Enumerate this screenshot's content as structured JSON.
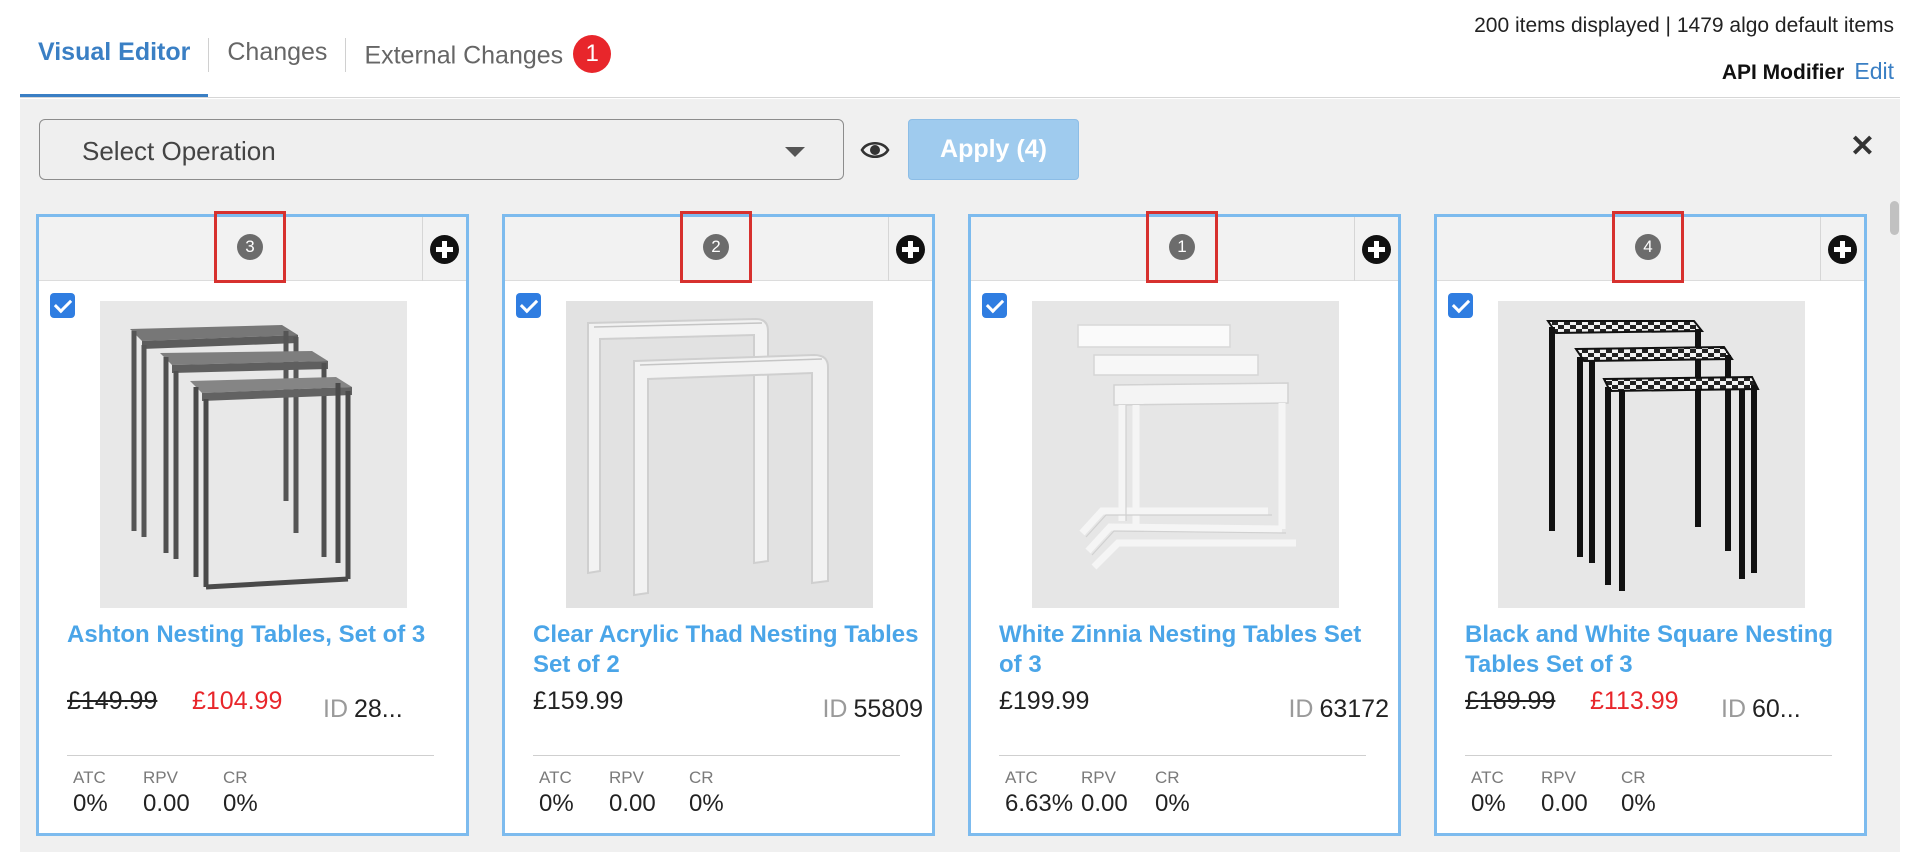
{
  "tabs": [
    {
      "label": "Visual Editor",
      "active": true
    },
    {
      "label": "Changes",
      "active": false
    },
    {
      "label": "External Changes",
      "active": false,
      "badge": "1"
    }
  ],
  "summary": {
    "items_text": "200 items displayed | 1479 algo default items",
    "api_label": "API Modifier",
    "edit_label": "Edit"
  },
  "toolbar": {
    "select_placeholder": "Select Operation",
    "apply_label": "Apply (4)",
    "close_symbol": "✕"
  },
  "metric_labels": {
    "atc": "ATC",
    "rpv": "RPV",
    "cr": "CR"
  },
  "id_label": "ID",
  "cards": [
    {
      "rank": "3",
      "checked": true,
      "title": "Ashton Nesting Tables, Set of 3",
      "old_price": "£149.99",
      "price": "£104.99",
      "on_sale": true,
      "id": "28...",
      "atc": "0%",
      "rpv": "0.00",
      "cr": "0%",
      "image": "grey-metal-nesting-tables"
    },
    {
      "rank": "2",
      "checked": true,
      "title": "Clear Acrylic Thad Nesting Tables Set of 2",
      "old_price": "",
      "price": "£159.99",
      "on_sale": false,
      "id": "55809",
      "atc": "0%",
      "rpv": "0.00",
      "cr": "0%",
      "image": "clear-acrylic-nesting-tables"
    },
    {
      "rank": "1",
      "checked": true,
      "title": "White Zinnia Nesting Tables Set of 3",
      "old_price": "",
      "price": "£199.99",
      "on_sale": false,
      "id": "63172",
      "atc": "6.63%",
      "rpv": "0.00",
      "cr": "0%",
      "image": "white-nesting-tables"
    },
    {
      "rank": "4",
      "checked": true,
      "title": "Black and White Square Nesting Tables Set of 3",
      "old_price": "£189.99",
      "price": "£113.99",
      "on_sale": true,
      "id": "60...",
      "atc": "0%",
      "rpv": "0.00",
      "cr": "0%",
      "image": "black-white-nesting-tables"
    }
  ],
  "colors": {
    "accent": "#3a7fc4",
    "title_link": "#4aa5e8",
    "sale_price": "#e8262b",
    "card_border": "#7dbbee",
    "rank_highlight": "#d7312e",
    "apply_button": "#9fcbee"
  }
}
